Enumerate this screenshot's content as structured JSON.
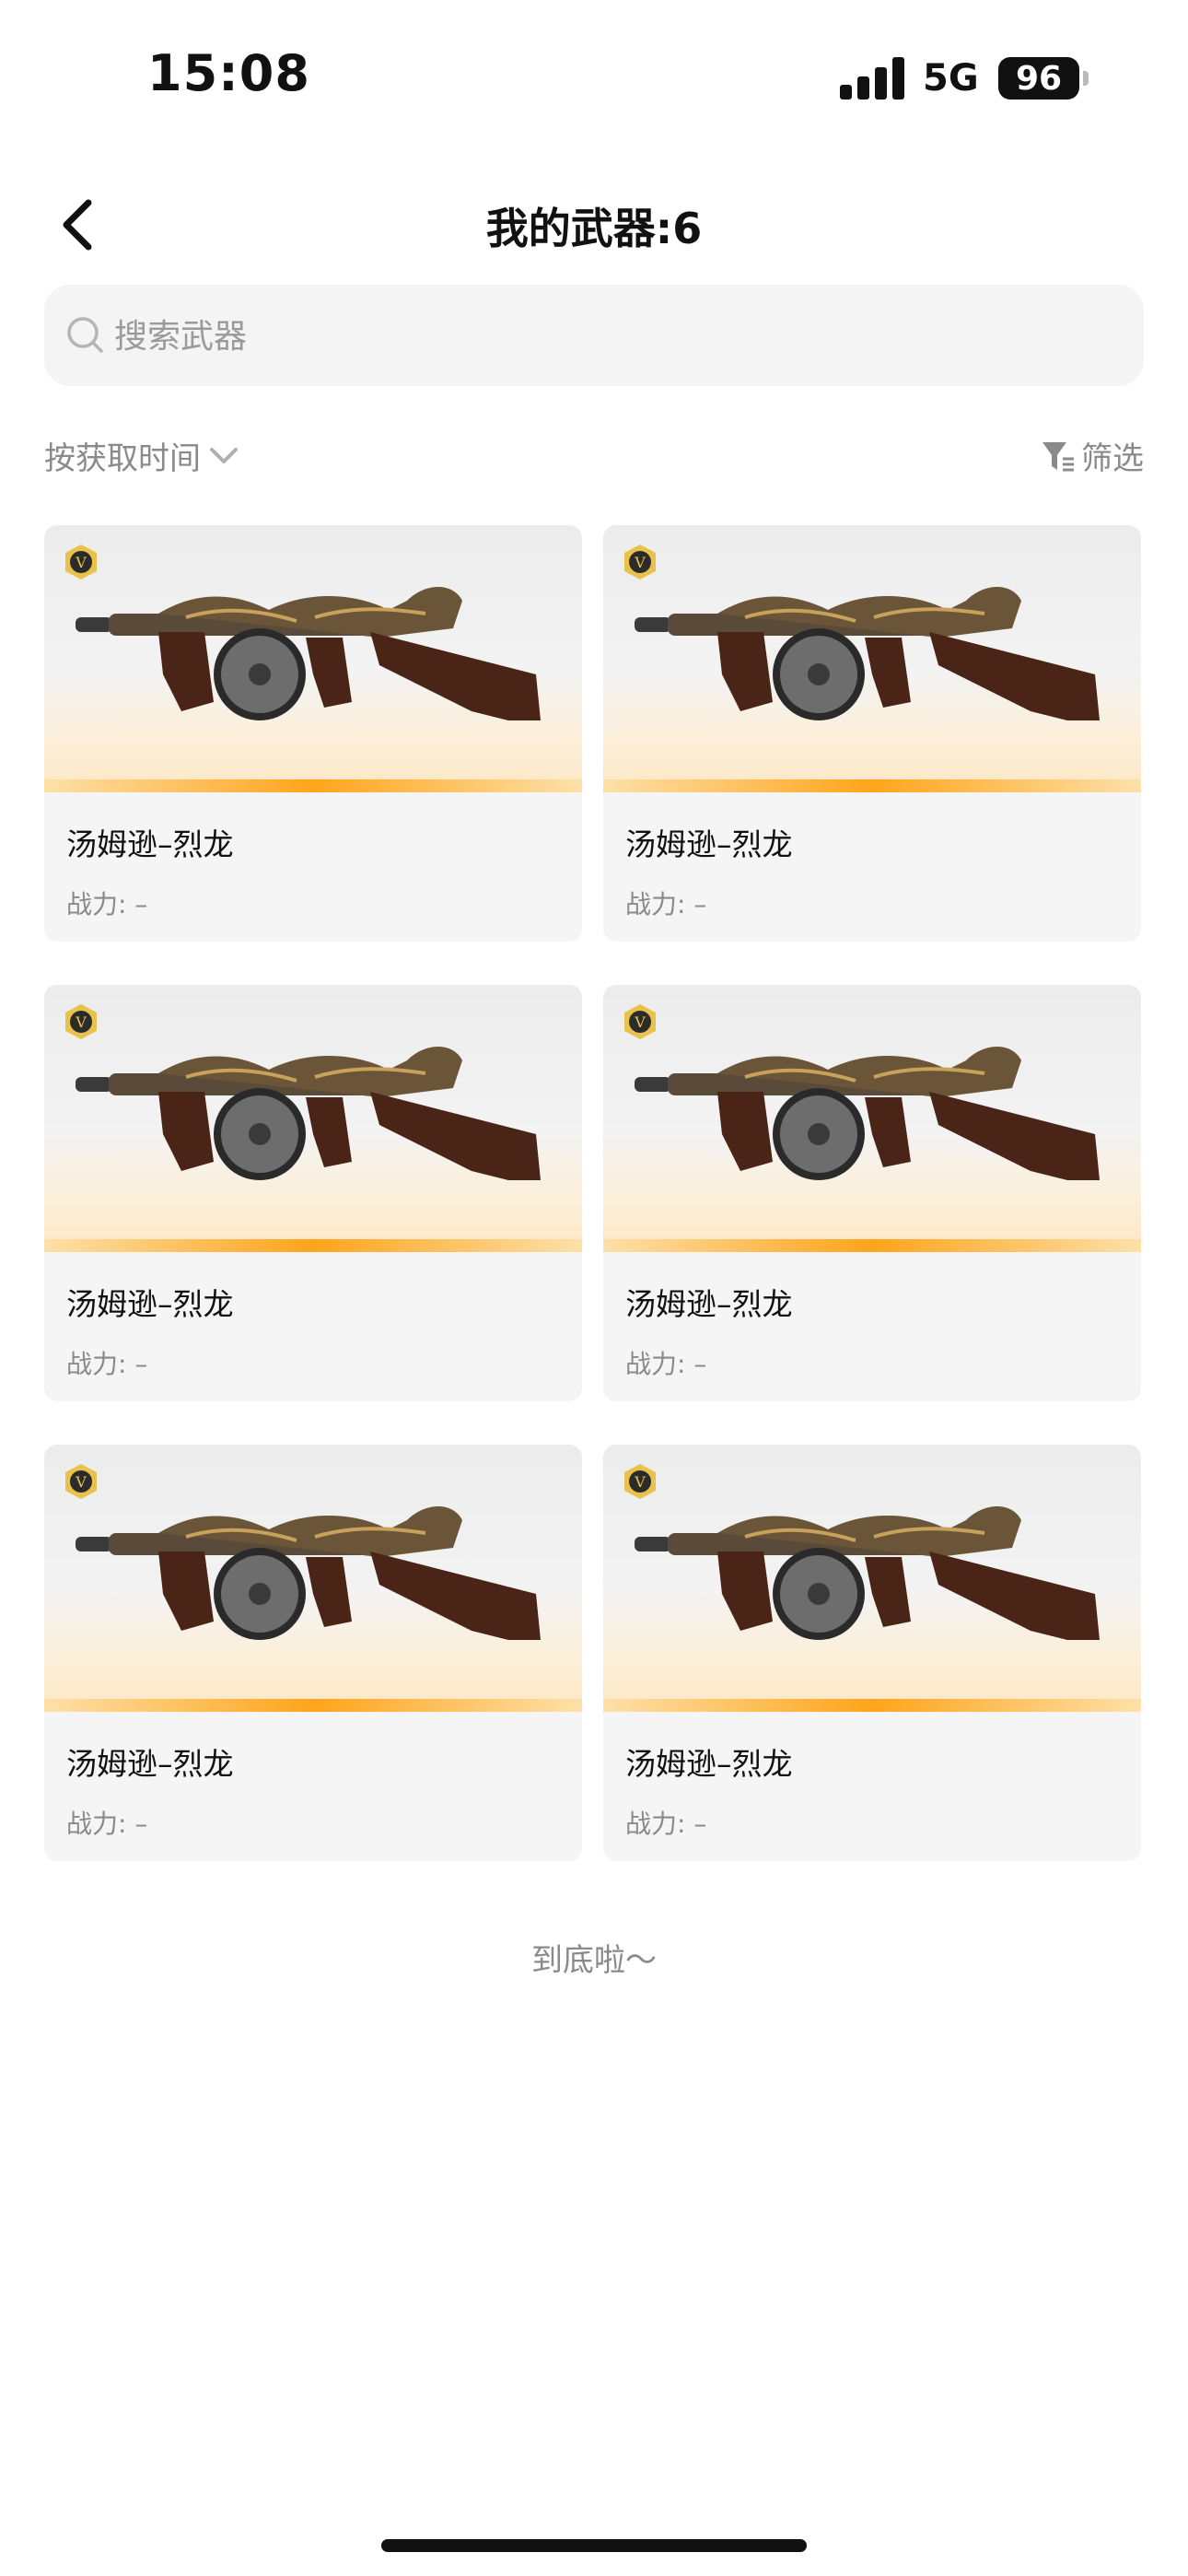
{
  "status": {
    "time": "15:08",
    "network": "5G",
    "battery": "96"
  },
  "header": {
    "title": "我的武器:6"
  },
  "search": {
    "placeholder": "搜索武器"
  },
  "toolbar": {
    "sort_label": "按获取时间",
    "filter_label": "筛选"
  },
  "weapons": [
    {
      "name": "汤姆逊–烈龙",
      "power": "战力: –",
      "badge": "V"
    },
    {
      "name": "汤姆逊–烈龙",
      "power": "战力: –",
      "badge": "V"
    },
    {
      "name": "汤姆逊–烈龙",
      "power": "战力: –",
      "badge": "V"
    },
    {
      "name": "汤姆逊–烈龙",
      "power": "战力: –",
      "badge": "V"
    },
    {
      "name": "汤姆逊–烈龙",
      "power": "战力: –",
      "badge": "V"
    },
    {
      "name": "汤姆逊–烈龙",
      "power": "战力: –",
      "badge": "V"
    }
  ],
  "footer": {
    "end_text": "到底啦～"
  },
  "colors": {
    "accent_bar": "#ffa41b",
    "badge_gold": "#e8c24a"
  }
}
